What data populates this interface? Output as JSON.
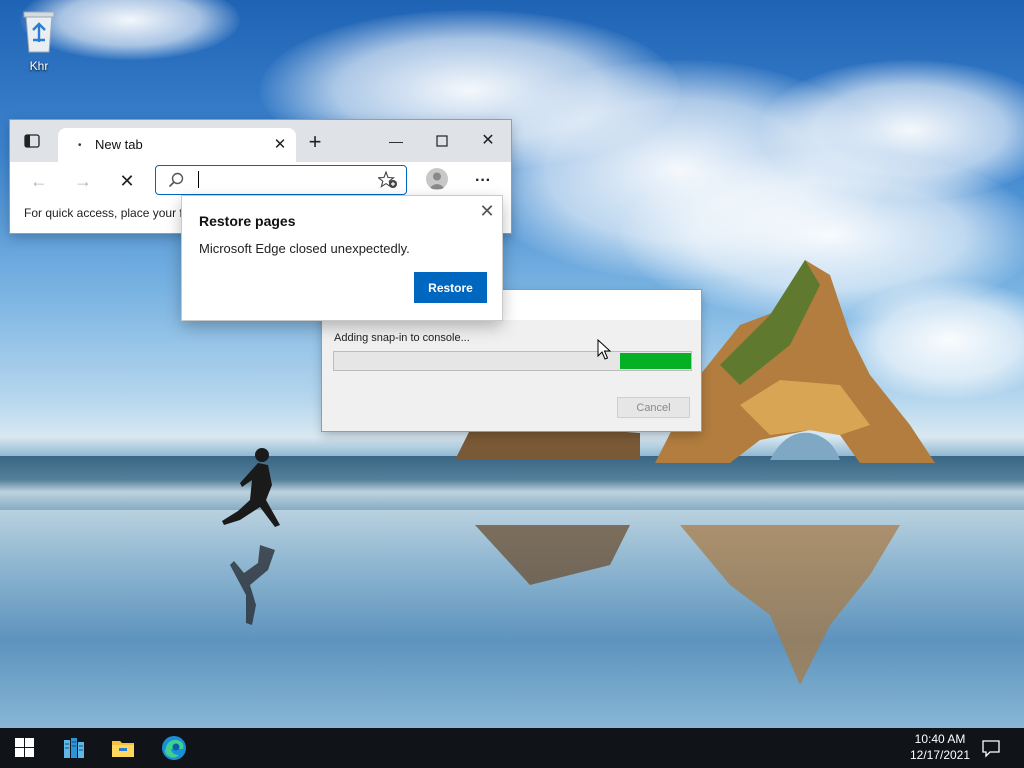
{
  "desktop": {
    "icons": [
      {
        "label": "Khr",
        "icon": "recycle-bin-icon"
      }
    ]
  },
  "edge": {
    "tab_title": "New tab",
    "address_value": "",
    "favorites_hint": "For quick access, place your f",
    "icons": [
      "tab-actions-icon",
      "close-tab-icon",
      "new-tab-icon",
      "minimize-icon",
      "maximize-icon",
      "close-window-icon",
      "back-icon",
      "forward-icon",
      "stop-loading-icon",
      "search-icon",
      "add-favorite-icon",
      "profile-icon",
      "more-icon"
    ]
  },
  "restore_popup": {
    "title": "Restore pages",
    "message": "Microsoft Edge closed unexpectedly.",
    "button": "Restore"
  },
  "snapin_dialog": {
    "status": "Adding snap-in to console...",
    "progress": {
      "fill_start": 0.8,
      "fill_end": 1.0
    },
    "cancel": "Cancel",
    "cancel_enabled": false
  },
  "taskbar": {
    "items": [
      "start-icon",
      "server-manager-icon",
      "file-explorer-icon",
      "edge-icon"
    ],
    "time": "10:40 AM",
    "date": "12/17/2021"
  },
  "colors": {
    "accent": "#0067c0",
    "progress": "#06b025",
    "taskbar": "#101418"
  }
}
